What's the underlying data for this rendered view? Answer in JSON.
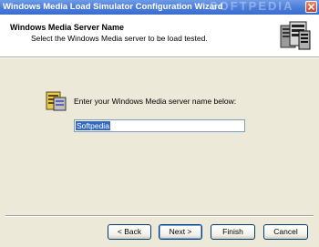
{
  "window": {
    "title": "Windows Media Load Simulator Configuration Wizard",
    "watermark": "SOFTPEDIA"
  },
  "header": {
    "title": "Windows Media Server Name",
    "subtitle": "Select the Windows Media server to be load tested."
  },
  "content": {
    "prompt": "Enter your Windows Media server name below:",
    "server_name_value": "Softpedia"
  },
  "buttons": {
    "back": "< Back",
    "next": "Next >",
    "finish": "Finish",
    "cancel": "Cancel"
  },
  "colors": {
    "titlebar": "#4A7CD8",
    "dialog_background": "#ECE9D8",
    "selection": "#316AC5"
  },
  "icons": [
    "close-icon",
    "server-wizard-icon",
    "server-config-icon"
  ]
}
